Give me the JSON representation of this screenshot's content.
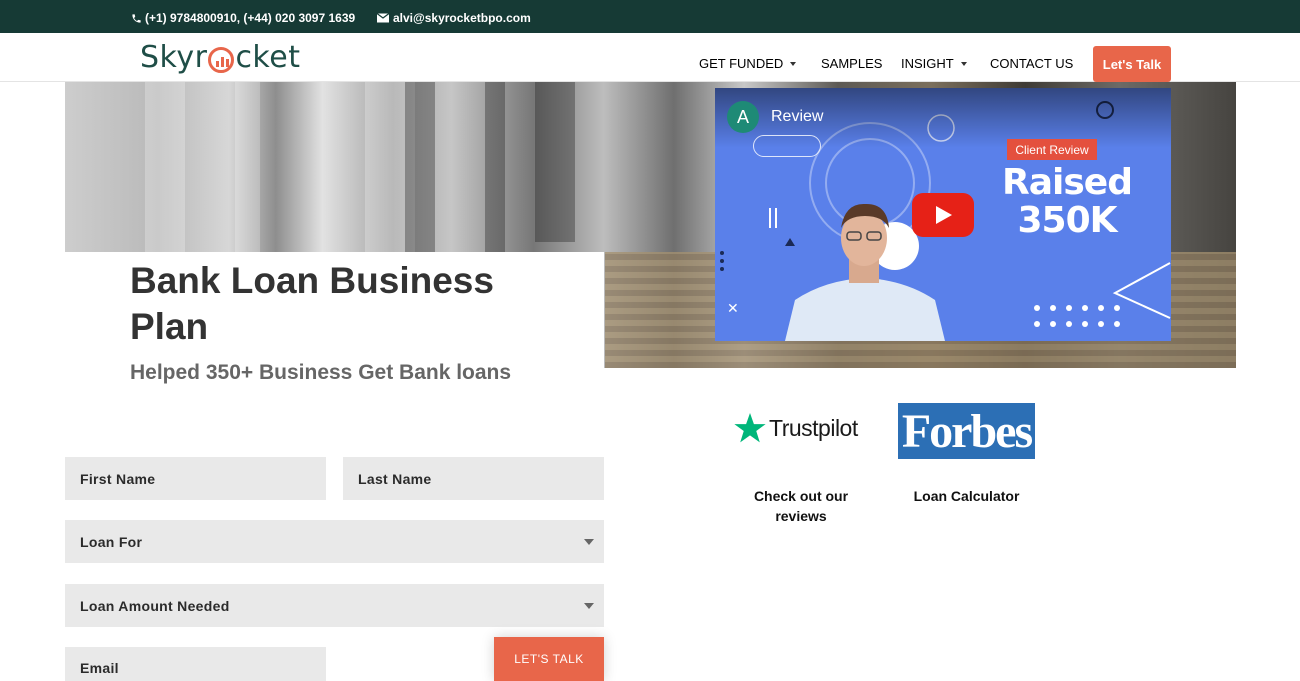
{
  "topbar": {
    "phone": "(+1) 9784800910, (+44) 020 3097 1639",
    "email": "alvi@skyrocketbpo.com",
    "bg_color": "#163a35"
  },
  "header": {
    "logo_pre": "Skyr",
    "logo_post": "cket",
    "nav": [
      {
        "label": "GET FUNDED",
        "has_dropdown": true
      },
      {
        "label": "SAMPLES",
        "has_dropdown": false
      },
      {
        "label": "INSIGHT",
        "has_dropdown": true
      },
      {
        "label": "CONTACT US",
        "has_dropdown": false
      }
    ],
    "cta_label": "Let's Talk",
    "accent_color": "#e8664a"
  },
  "hero": {
    "title": "Bank Loan Business Plan",
    "subtitle": "Helped 350+ Business Get Bank loans"
  },
  "video": {
    "channel_initial": "A",
    "title": "Review",
    "badge": "Client Review",
    "headline_line1": "Raised",
    "headline_line2": "350K"
  },
  "badges": {
    "trustpilot": "Trustpilot",
    "forbes": "Forbes",
    "trustpilot_link": "Check out our reviews",
    "forbes_link": "Loan Calculator"
  },
  "form": {
    "first_name": "First Name",
    "last_name": "Last Name",
    "loan_for": "Loan For",
    "loan_amount": "Loan Amount Needed",
    "email": "Email",
    "submit_label": "LET'S TALK"
  }
}
